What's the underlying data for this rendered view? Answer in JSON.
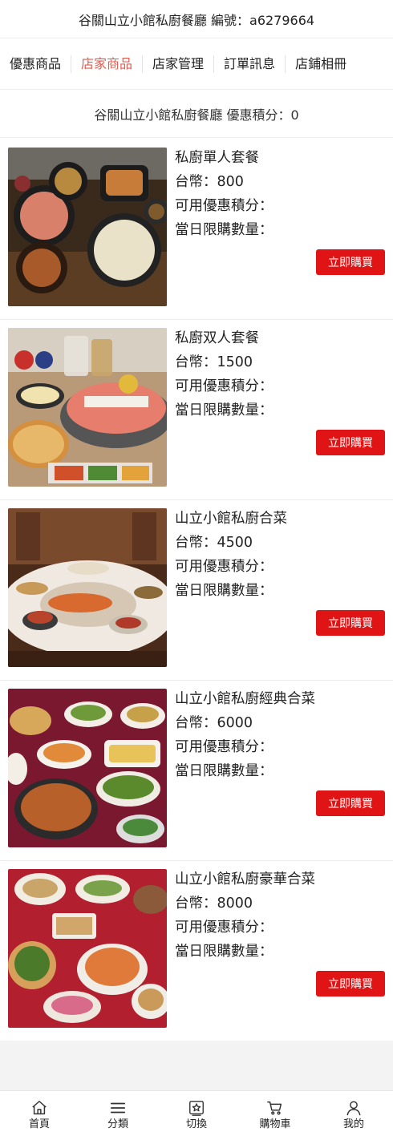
{
  "header": {
    "title": "谷關山立小館私廚餐廳 編號：a6279664"
  },
  "tabs": [
    {
      "label": "優惠商品",
      "active": false
    },
    {
      "label": "店家商品",
      "active": true
    },
    {
      "label": "店家管理",
      "active": false
    },
    {
      "label": "訂單訊息",
      "active": false
    },
    {
      "label": "店鋪相冊",
      "active": false
    }
  ],
  "points_bar": {
    "text": "谷關山立小館私廚餐廳 優惠積分：0"
  },
  "colors": {
    "accent": "#e25c4f",
    "buy_button": "#e01414"
  },
  "products": [
    {
      "name": "私廚單人套餐",
      "price": "台幣：800",
      "points": "可用優惠積分：",
      "limit": "當日限購數量：",
      "buy_label": "立即購買",
      "image": "set-meal-photo"
    },
    {
      "name": "私廚双人套餐",
      "price": "台幣：1500",
      "points": "可用優惠積分：",
      "limit": "當日限購數量：",
      "buy_label": "立即購買",
      "image": "hotpot-meal-photo"
    },
    {
      "name": "山立小館私廚合菜",
      "price": "台幣：4500",
      "points": "可用優惠積分：",
      "limit": "當日限購數量：",
      "buy_label": "立即購買",
      "image": "banquet-table-photo"
    },
    {
      "name": "山立小館私廚經典合菜",
      "price": "台幣：6000",
      "points": "可用優惠積分：",
      "limit": "當日限購數量：",
      "buy_label": "立即購買",
      "image": "classic-dishes-photo"
    },
    {
      "name": "山立小館私廚豪華合菜",
      "price": "台幣：8000",
      "points": "可用優惠積分：",
      "limit": "當日限購數量：",
      "buy_label": "立即購買",
      "image": "deluxe-dishes-photo"
    }
  ],
  "bottom_nav": [
    {
      "label": "首頁",
      "icon": "home-icon"
    },
    {
      "label": "分類",
      "icon": "menu-lines-icon"
    },
    {
      "label": "切換",
      "icon": "star-box-icon"
    },
    {
      "label": "購物車",
      "icon": "cart-icon"
    },
    {
      "label": "我的",
      "icon": "user-icon"
    }
  ]
}
